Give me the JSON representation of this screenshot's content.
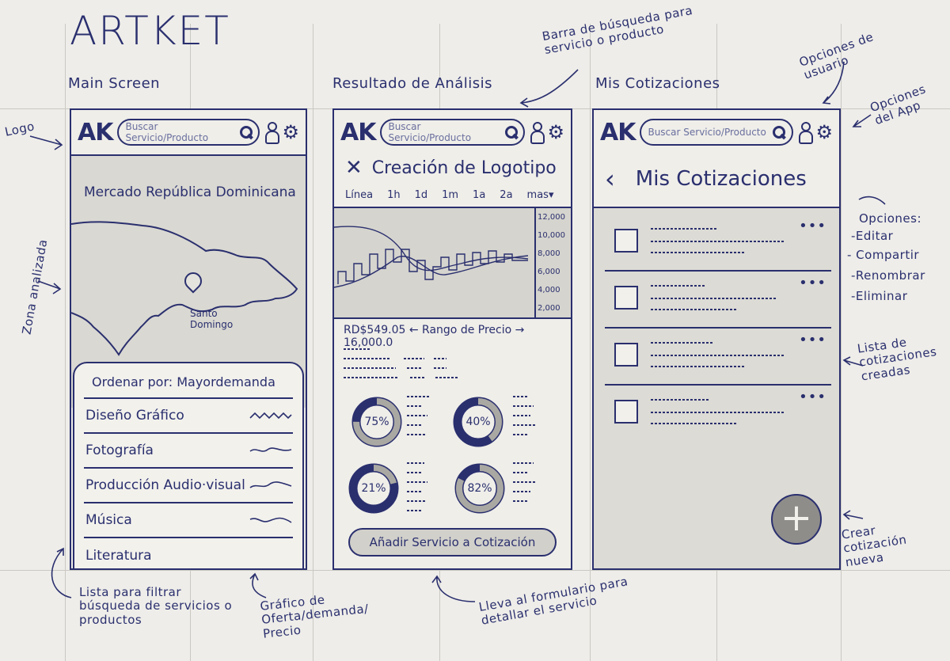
{
  "title": "ARTKET",
  "sections": {
    "main": "Main Screen",
    "analysis": "Resultado de Análisis",
    "quotes": "Mis Cotizaciones"
  },
  "annotations": {
    "logo": "Logo",
    "zone": "Zona analizada",
    "search_bar": "Barra de búsqueda para servicio o producto",
    "user_options": "Opciones de usuario",
    "app_options": "Opciones del App",
    "options_list": "Opciones:",
    "options_items": [
      "-Editar",
      "- Compartir",
      "-Renombrar",
      "-Eliminar"
    ],
    "quotes_list": "Lista de cotizaciones creadas",
    "create_quote": "Crear cotización nueva",
    "filter_list": "Lista para filtrar búsqueda de servicios o productos",
    "supply_chart": "Gráfico de Oferta/demanda/ Precio",
    "form_note": "Lleva al formulario para detallar el servicio"
  },
  "header": {
    "logo": "AK",
    "search_placeholder": "Buscar Servicio/Producto"
  },
  "main_screen": {
    "map_title": "Mercado República Dominicana",
    "map_pin_label": "Santo Domingo",
    "sort_label": "Ordenar por: Mayordemanda",
    "categories": [
      "Diseño Gráfico",
      "Fotografía",
      "Producción Audio·visual",
      "Música",
      "Literatura"
    ]
  },
  "analysis_screen": {
    "title": "Creación de Logotipo",
    "timeframes": [
      "Línea",
      "1h",
      "1d",
      "1m",
      "1a",
      "2a",
      "mas▾"
    ],
    "y_axis": [
      "12,000",
      "10,000",
      "8,000",
      "6,000",
      "4,000",
      "2,000"
    ],
    "price_min": "RD$549.05",
    "price_range_label": "Rango de Precio",
    "price_max": "16,000.0",
    "donuts": [
      "75%",
      "40%",
      "21%",
      "82%"
    ],
    "donut_values": [
      0.75,
      0.4,
      0.21,
      0.82
    ],
    "cta_label": "Añadir Servicio a Cotización"
  },
  "quotes_screen": {
    "title": "Mis Cotizaciones",
    "dots": "•••",
    "fab": "+"
  }
}
